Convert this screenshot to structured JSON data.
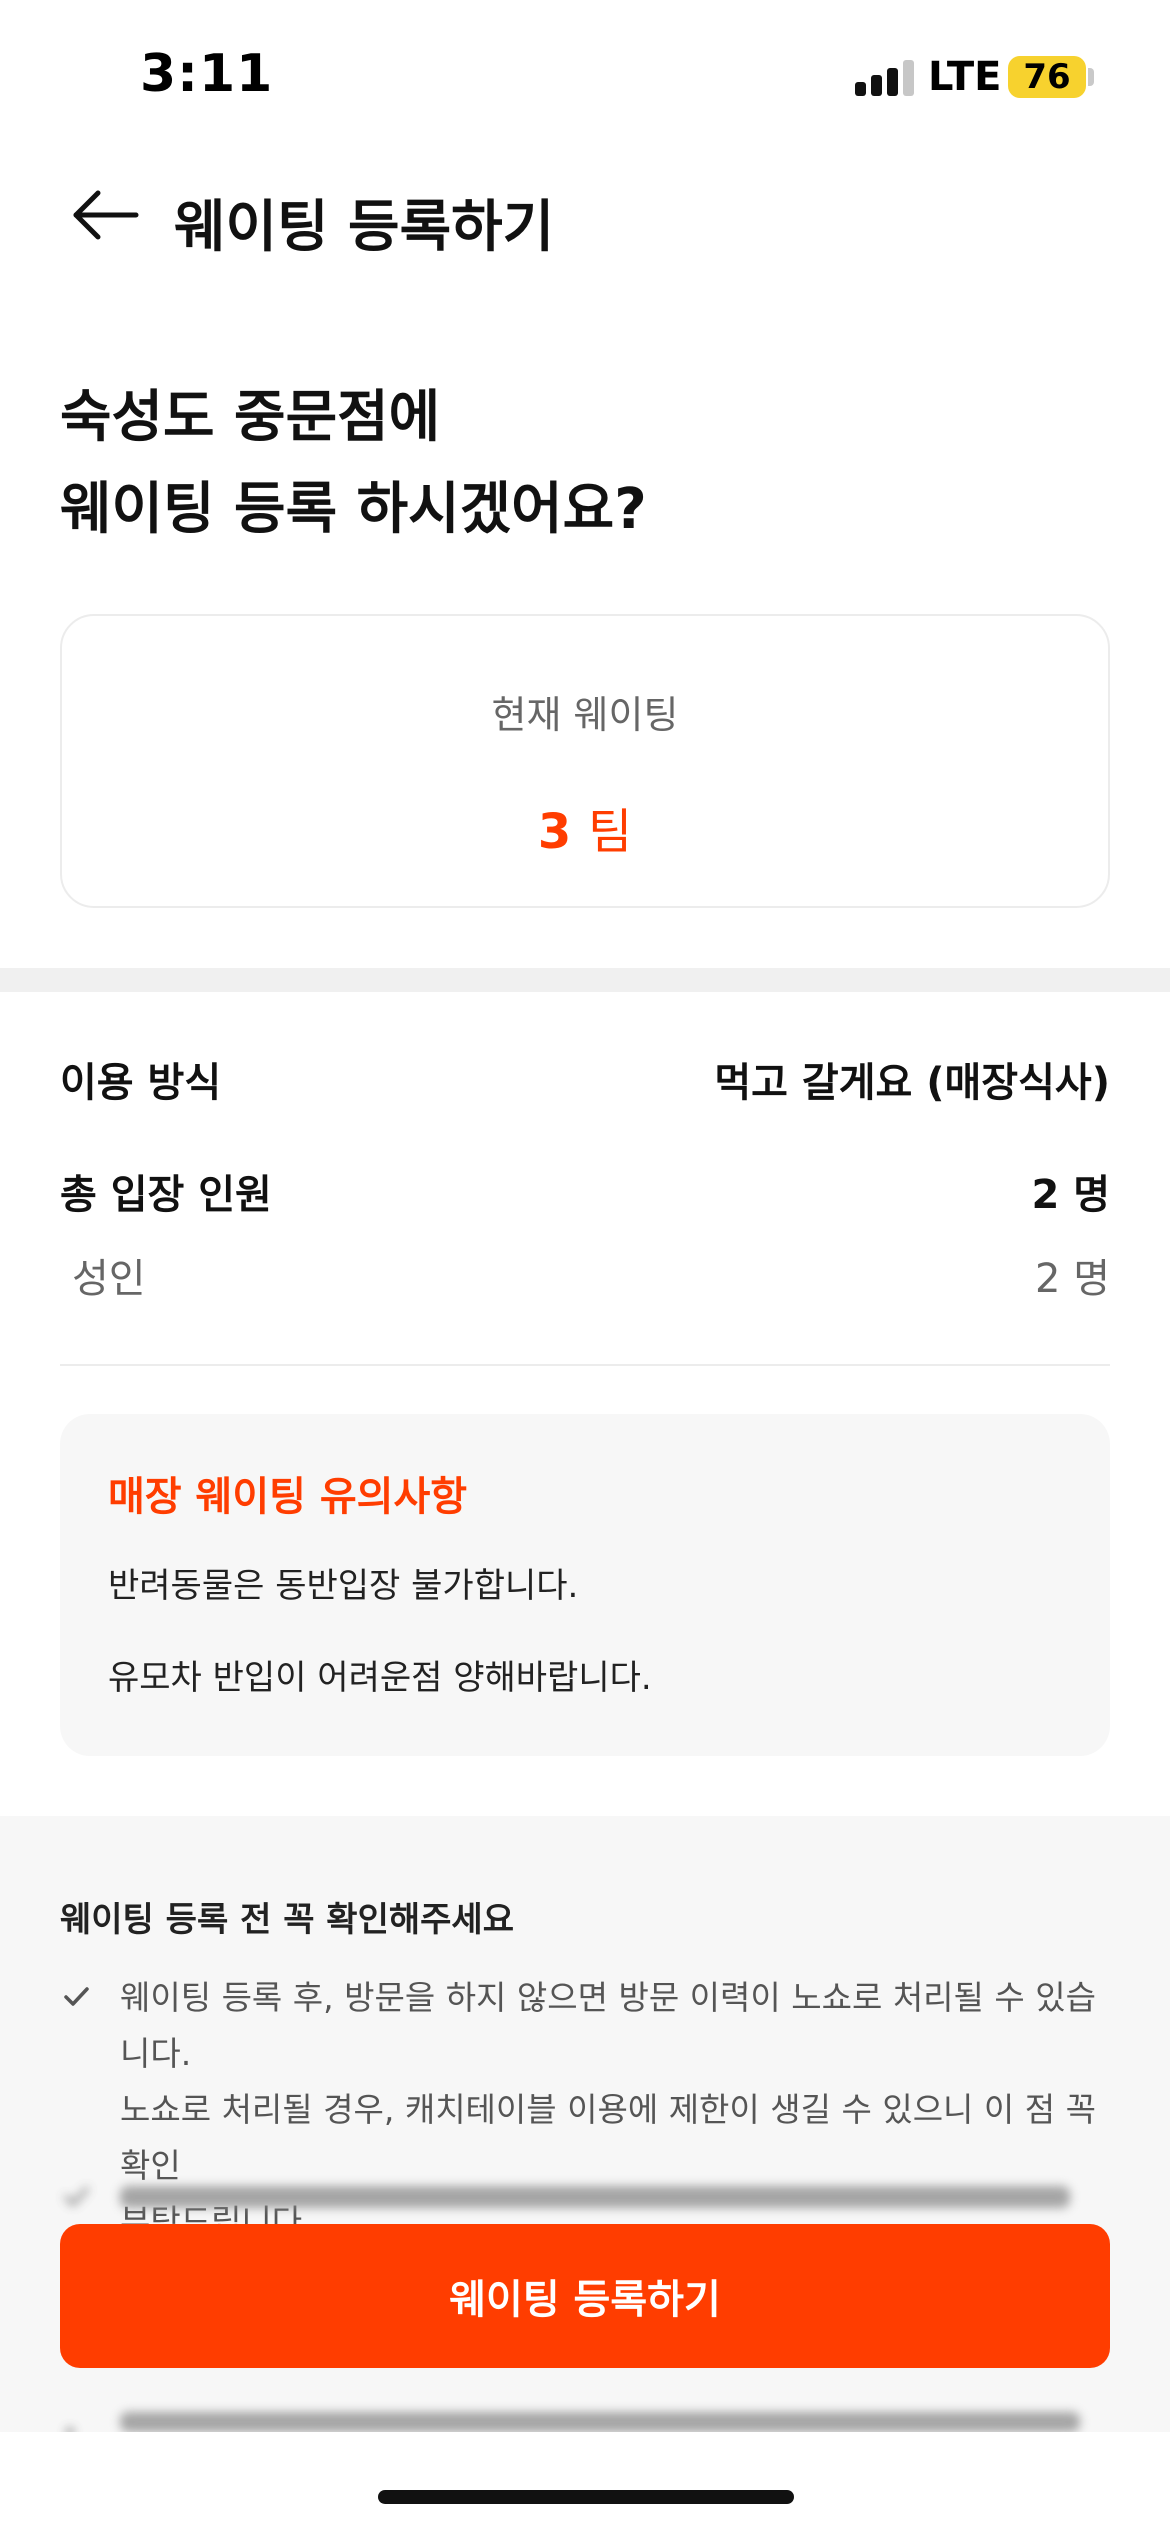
{
  "status_bar": {
    "time": "3:11",
    "network": "LTE",
    "battery": "76",
    "battery_color": "#f7d22e"
  },
  "header": {
    "back_icon": "arrow-left-icon",
    "title": "웨이팅 등록하기"
  },
  "question": {
    "line1": "숙성도 중문점에",
    "line2": "웨이팅 등록 하시겠어요?"
  },
  "current_waiting": {
    "label": "현재 웨이팅",
    "count": "3",
    "unit": "팀"
  },
  "details": {
    "usage_label": "이용 방식",
    "usage_value": "먹고 갈게요 (매장식사)",
    "total_label": "총 입장 인원",
    "total_value": "2 명",
    "adult_label": "성인",
    "adult_value": "2 명"
  },
  "notice": {
    "title": "매장 웨이팅 유의사항",
    "lines": [
      "반려동물은 동반입장 불가합니다.",
      "유모차 반입이 어려운점 양해바랍니다."
    ]
  },
  "checklist": {
    "heading": "웨이팅 등록 전 꼭 확인해주세요",
    "items": [
      {
        "icon": "check-icon",
        "lines": [
          "웨이팅 등록 후, 방문을 하지 않으면 방문 이력이 노쇼로 처리될 수 있습니다.",
          "노쇼로 처리될 경우, 캐치테이블 이용에 제한이 생길 수 있으니 이 점 꼭 확인",
          "부탁드립니다."
        ]
      }
    ]
  },
  "cta": {
    "label": "웨이팅 등록하기"
  },
  "colors": {
    "accent": "#ff3d00",
    "card_border": "#ececec",
    "section_bg": "#f7f7f7"
  }
}
